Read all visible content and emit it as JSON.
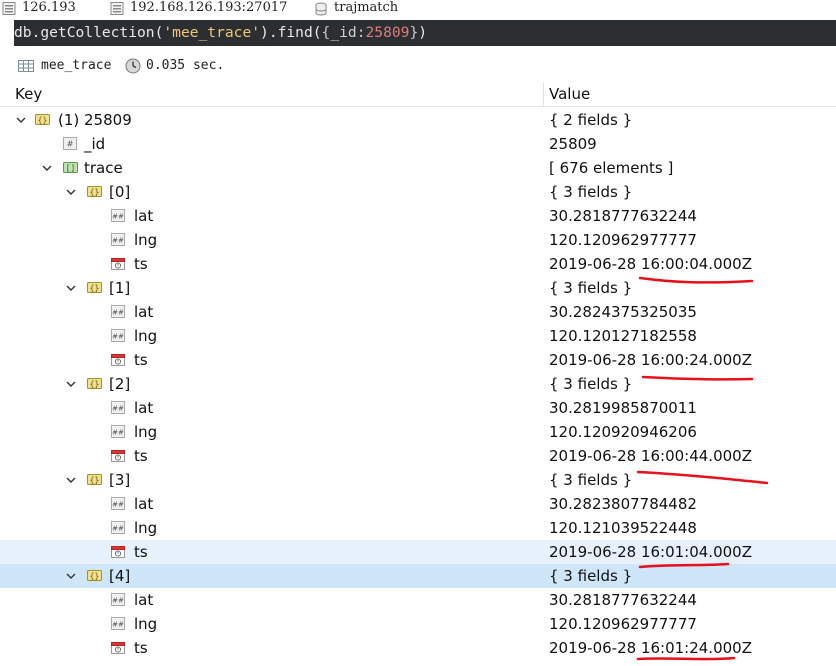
{
  "connection": {
    "server_short": "126.193",
    "server_full": "192.168.126.193:27017",
    "database": "trajmatch"
  },
  "query": {
    "prefix": "db.getCollection(",
    "collection_arg": "'mee_trace'",
    "middle": ").find(",
    "open_brace": "{",
    "key": "_id",
    "colon": ":",
    "id_value": "25809",
    "close_brace": "}",
    "suffix": ")"
  },
  "info": {
    "collection": "mee_trace",
    "elapsed": "0.035 sec."
  },
  "header": {
    "key": "Key",
    "value": "Value"
  },
  "rows": [
    {
      "key": "(1) 25809",
      "value": "{ 2 fields }",
      "indent": 0,
      "icon": "object-icon",
      "expand": true
    },
    {
      "key": "_id",
      "value": "25809",
      "indent": 1,
      "icon": "number-icon",
      "expand": false
    },
    {
      "key": "trace",
      "value": "[ 676 elements ]",
      "indent": 1,
      "icon": "array-icon",
      "expand": true
    },
    {
      "key": "[0]",
      "value": "{ 3 fields }",
      "indent": 2,
      "icon": "object-icon",
      "expand": true
    },
    {
      "key": "lat",
      "value": "30.2818777632244",
      "indent": 3,
      "icon": "double-icon",
      "expand": false
    },
    {
      "key": "lng",
      "value": "120.120962977777",
      "indent": 3,
      "icon": "double-icon",
      "expand": false
    },
    {
      "key": "ts",
      "value": "2019-06-28 16:00:04.000Z",
      "indent": 3,
      "icon": "date-icon",
      "expand": false
    },
    {
      "key": "[1]",
      "value": "{ 3 fields }",
      "indent": 2,
      "icon": "object-icon",
      "expand": true
    },
    {
      "key": "lat",
      "value": "30.2824375325035",
      "indent": 3,
      "icon": "double-icon",
      "expand": false
    },
    {
      "key": "lng",
      "value": "120.120127182558",
      "indent": 3,
      "icon": "double-icon",
      "expand": false
    },
    {
      "key": "ts",
      "value": "2019-06-28 16:00:24.000Z",
      "indent": 3,
      "icon": "date-icon",
      "expand": false
    },
    {
      "key": "[2]",
      "value": "{ 3 fields }",
      "indent": 2,
      "icon": "object-icon",
      "expand": true
    },
    {
      "key": "lat",
      "value": "30.2819985870011",
      "indent": 3,
      "icon": "double-icon",
      "expand": false
    },
    {
      "key": "lng",
      "value": "120.120920946206",
      "indent": 3,
      "icon": "double-icon",
      "expand": false
    },
    {
      "key": "ts",
      "value": "2019-06-28 16:00:44.000Z",
      "indent": 3,
      "icon": "date-icon",
      "expand": false
    },
    {
      "key": "[3]",
      "value": "{ 3 fields }",
      "indent": 2,
      "icon": "object-icon",
      "expand": true
    },
    {
      "key": "lat",
      "value": "30.2823807784482",
      "indent": 3,
      "icon": "double-icon",
      "expand": false
    },
    {
      "key": "lng",
      "value": "120.121039522448",
      "indent": 3,
      "icon": "double-icon",
      "expand": false
    },
    {
      "key": "ts",
      "value": "2019-06-28 16:01:04.000Z",
      "indent": 3,
      "icon": "date-icon",
      "expand": false,
      "state": "hover"
    },
    {
      "key": "[4]",
      "value": "{ 3 fields }",
      "indent": 2,
      "icon": "object-icon",
      "expand": true,
      "state": "selected"
    },
    {
      "key": "lat",
      "value": "30.2818777632244",
      "indent": 3,
      "icon": "double-icon",
      "expand": false
    },
    {
      "key": "lng",
      "value": "120.120962977777",
      "indent": 3,
      "icon": "double-icon",
      "expand": false
    },
    {
      "key": "ts",
      "value": "2019-06-28 16:01:24.000Z",
      "indent": 3,
      "icon": "date-icon",
      "expand": false
    }
  ],
  "colors": {
    "query_bg": "#2b2f31",
    "annotation": "#e8101a",
    "selected_row": "#cfe6f8",
    "hover_row": "#e6f1fb"
  }
}
